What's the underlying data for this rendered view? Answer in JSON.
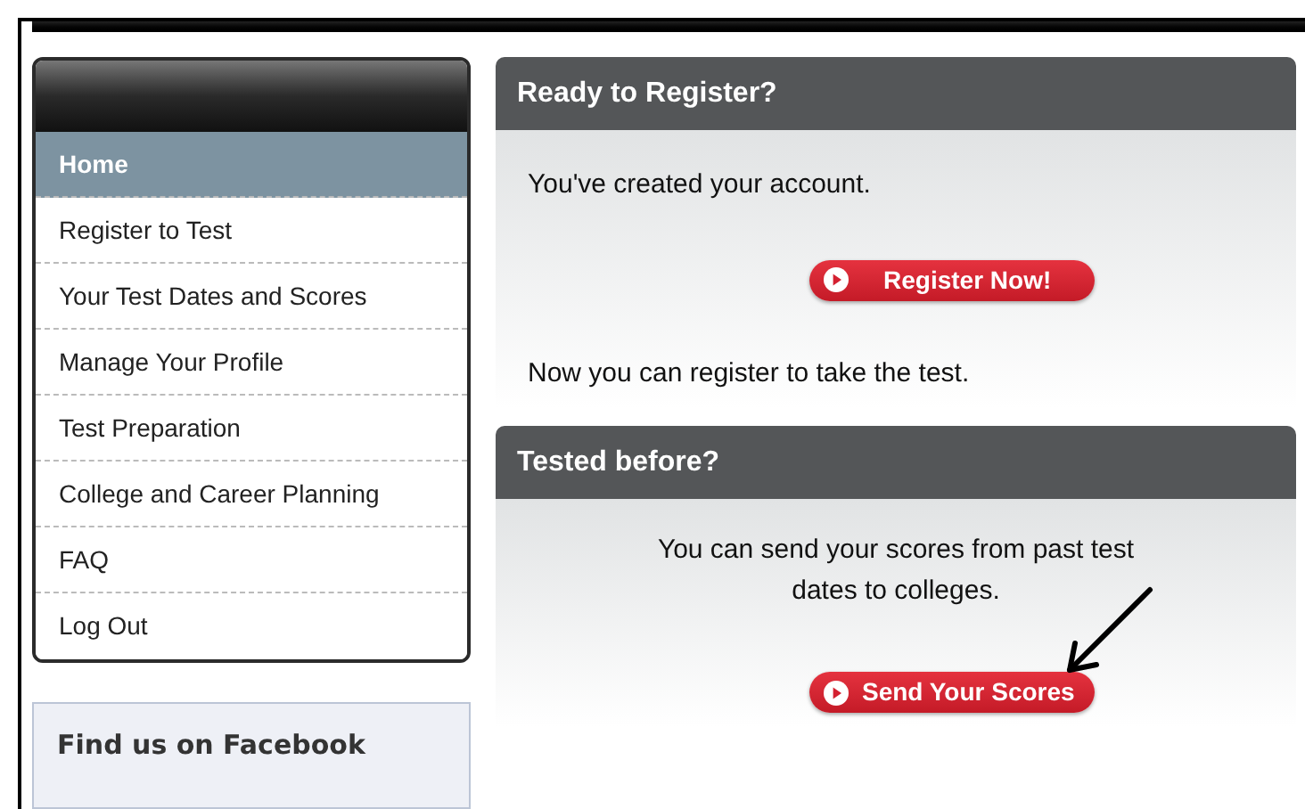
{
  "nav": {
    "items": [
      {
        "label": "Home",
        "selected": true
      },
      {
        "label": "Register to Test",
        "selected": false
      },
      {
        "label": "Your Test Dates and Scores",
        "selected": false
      },
      {
        "label": "Manage Your Profile",
        "selected": false
      },
      {
        "label": "Test Preparation",
        "selected": false
      },
      {
        "label": "College and Career Planning",
        "selected": false
      },
      {
        "label": "FAQ",
        "selected": false
      },
      {
        "label": "Log Out",
        "selected": false
      }
    ]
  },
  "facebook_box": {
    "title": "Find us on Facebook"
  },
  "panels": [
    {
      "title": "Ready to Register?",
      "intro": "You've created your account.",
      "button": "Register Now!",
      "note": "Now you can register to take the test.",
      "arrow": false
    },
    {
      "title": "Tested before?",
      "intro": "You can send your scores from past test dates to colleges.",
      "button": "Send Your Scores",
      "arrow": true
    }
  ]
}
